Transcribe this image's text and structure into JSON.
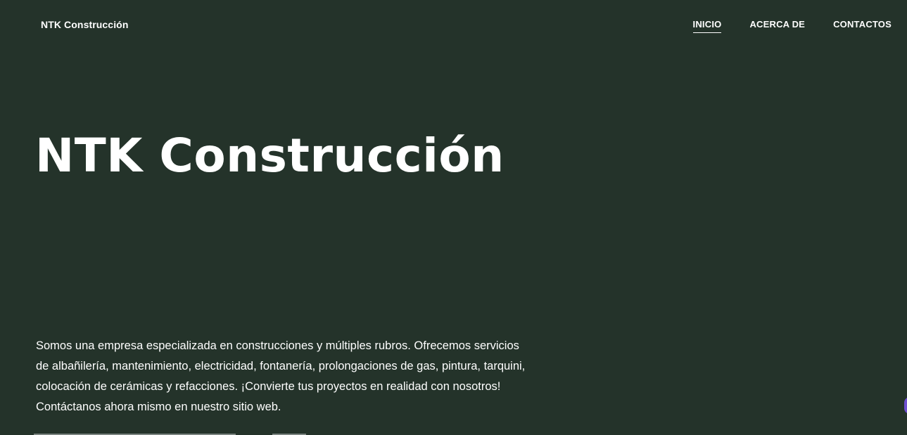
{
  "header": {
    "brand": "NTK Construcción",
    "nav": [
      {
        "label": "INICIO",
        "active": true
      },
      {
        "label": "ACERCA DE",
        "active": false
      },
      {
        "label": "CONTACTOS",
        "active": false
      }
    ]
  },
  "hero": {
    "title": "NTK Construcción",
    "description": "Somos una empresa especializada en construcciones y múltiples rubros. Ofrecemos servicios de albañilería, mantenimiento, electricidad, fontanería, prolongaciones de gas, pintura, tarquini, colocación de cerámicas y refacciones. ¡Convierte tus proyectos en realidad con nosotros! Contáctanos ahora mismo en nuestro sitio web."
  },
  "colors": {
    "background": "#24332a",
    "text": "#ffffff",
    "widget_accent": "#6e4fd0"
  }
}
